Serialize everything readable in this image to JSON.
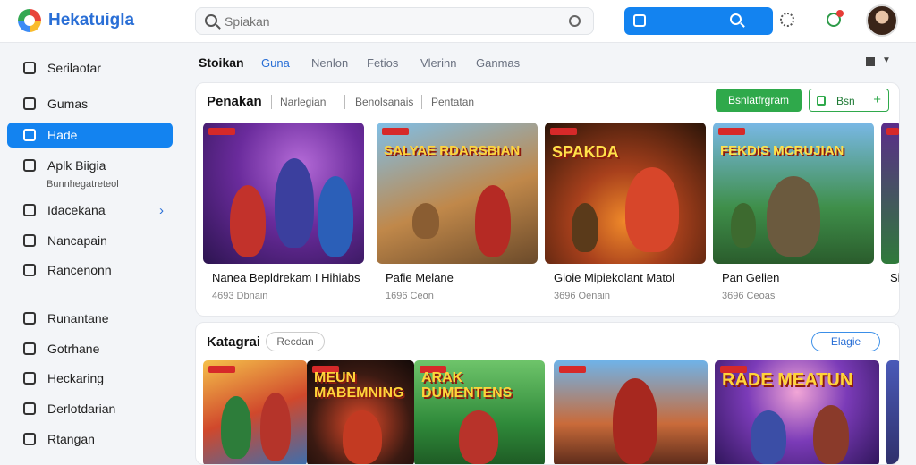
{
  "app": {
    "brand": "Hekatuigla"
  },
  "search": {
    "placeholder": "Spiakan"
  },
  "sidebar": {
    "items": [
      {
        "label": "Serilaotar",
        "active": false
      },
      {
        "label": "Gumas",
        "active": false
      },
      {
        "label": "Hade",
        "active": true
      },
      {
        "label": "Aplk Biigia",
        "sub": "Bunnhegatreteol",
        "active": false
      },
      {
        "label": "Idacekana",
        "chevron": "›",
        "active": false
      },
      {
        "label": "Nancapain",
        "active": false
      },
      {
        "label": "Rancenonn",
        "active": false
      },
      {
        "label": "Runantane",
        "active": false
      },
      {
        "label": "Gotrhane",
        "active": false
      },
      {
        "label": "Heckaring",
        "active": false
      },
      {
        "label": "Derlotdarian",
        "active": false
      },
      {
        "label": "Rtangan",
        "active": false
      }
    ]
  },
  "tabs": [
    {
      "label": "Stoikan"
    },
    {
      "label": "Guna"
    },
    {
      "label": "Nenlon"
    },
    {
      "label": "Fetios"
    },
    {
      "label": "Vlerinn"
    },
    {
      "label": "Ganmas"
    }
  ],
  "section1": {
    "title": "Penakan",
    "filters": [
      "Narlegian",
      "Benolsanais",
      "Pentatan"
    ],
    "primary_button": "Bsnlatfrgram",
    "secondary_button": "Bsn",
    "cards": [
      {
        "name": "Nanea Bepldrekam I Hihiabs",
        "meta": "4693 Dbnain",
        "art_title": ""
      },
      {
        "name": "Pafie Melane",
        "meta": "1696 Ceon",
        "art_title": "SALYAE RDARSBIAN"
      },
      {
        "name": "Gioie Mipiekolant Matol",
        "meta": "3696 Oenain",
        "art_title": "SPAKDA"
      },
      {
        "name": "Pan Gelien",
        "meta": "3696 Ceoas",
        "art_title": "FEKDIS MCRUJIAN"
      },
      {
        "name": "Sin",
        "meta": "",
        "art_title": ""
      }
    ]
  },
  "section2": {
    "title": "Katagrai",
    "pill": "Recdan",
    "right_pill": "Elagie",
    "thumbs": [
      {
        "art_title": ""
      },
      {
        "art_title": "MEUN MABEMNING"
      },
      {
        "art_title": "ARAK DUMENTENS"
      },
      {
        "art_title": ""
      },
      {
        "art_title": "RADE MEATUN"
      }
    ]
  },
  "colors": {
    "accent": "#1383f0",
    "green": "#2fa94b",
    "badge": "#d62929"
  }
}
